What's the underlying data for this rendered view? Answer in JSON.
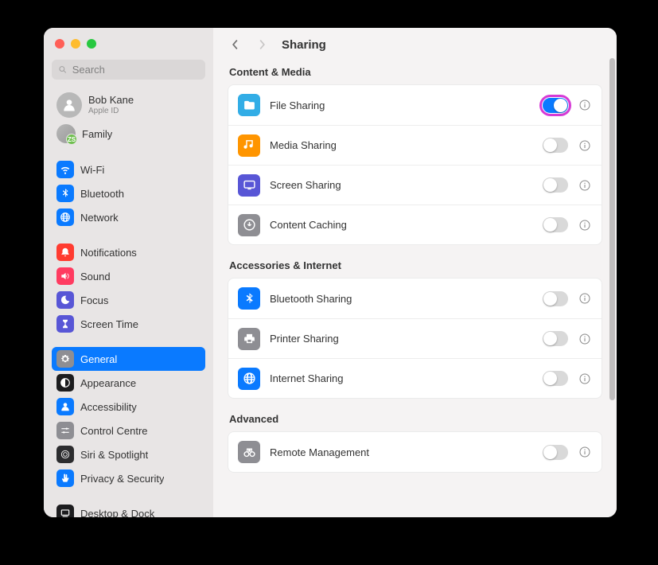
{
  "search": {
    "placeholder": "Search"
  },
  "user": {
    "name": "Bob Kane",
    "sub": "Apple ID"
  },
  "family": {
    "label": "Family",
    "badge": "ZS"
  },
  "sidebar_groups": [
    [
      {
        "id": "wifi",
        "label": "Wi-Fi",
        "bg": "#0a7aff",
        "icon": "wifi"
      },
      {
        "id": "bluetooth",
        "label": "Bluetooth",
        "bg": "#0a7aff",
        "icon": "bluetooth"
      },
      {
        "id": "network",
        "label": "Network",
        "bg": "#0a7aff",
        "icon": "globe"
      }
    ],
    [
      {
        "id": "notifications",
        "label": "Notifications",
        "bg": "#ff3b30",
        "icon": "bell"
      },
      {
        "id": "sound",
        "label": "Sound",
        "bg": "#ff3b60",
        "icon": "speaker"
      },
      {
        "id": "focus",
        "label": "Focus",
        "bg": "#5856d6",
        "icon": "moon"
      },
      {
        "id": "screen-time",
        "label": "Screen Time",
        "bg": "#5856d6",
        "icon": "hourglass"
      }
    ],
    [
      {
        "id": "general",
        "label": "General",
        "bg": "#8e8e93",
        "icon": "gear",
        "selected": true
      },
      {
        "id": "appearance",
        "label": "Appearance",
        "bg": "#1c1c1e",
        "icon": "appearance"
      },
      {
        "id": "accessibility",
        "label": "Accessibility",
        "bg": "#0a7aff",
        "icon": "person"
      },
      {
        "id": "control-centre",
        "label": "Control Centre",
        "bg": "#8e8e93",
        "icon": "sliders"
      },
      {
        "id": "siri",
        "label": "Siri & Spotlight",
        "bg": "#2c2c2e",
        "icon": "siri"
      },
      {
        "id": "privacy",
        "label": "Privacy & Security",
        "bg": "#0a7aff",
        "icon": "hand"
      }
    ],
    [
      {
        "id": "desktop-dock",
        "label": "Desktop & Dock",
        "bg": "#1c1c1e",
        "icon": "dock"
      }
    ]
  ],
  "page": {
    "title": "Sharing"
  },
  "sections": [
    {
      "title": "Content & Media",
      "rows": [
        {
          "id": "file-sharing",
          "label": "File Sharing",
          "bg": "#32ade6",
          "icon": "folder",
          "on": true,
          "highlight": true
        },
        {
          "id": "media-sharing",
          "label": "Media Sharing",
          "bg": "#ff9500",
          "icon": "media",
          "on": false
        },
        {
          "id": "screen-sharing",
          "label": "Screen Sharing",
          "bg": "#5856d6",
          "icon": "screen",
          "on": false
        },
        {
          "id": "content-caching",
          "label": "Content Caching",
          "bg": "#8e8e93",
          "icon": "download",
          "on": false
        }
      ]
    },
    {
      "title": "Accessories & Internet",
      "rows": [
        {
          "id": "bluetooth-sharing",
          "label": "Bluetooth Sharing",
          "bg": "#0a7aff",
          "icon": "bluetooth",
          "on": false
        },
        {
          "id": "printer-sharing",
          "label": "Printer Sharing",
          "bg": "#8e8e93",
          "icon": "printer",
          "on": false
        },
        {
          "id": "internet-sharing",
          "label": "Internet Sharing",
          "bg": "#0a7aff",
          "icon": "globe",
          "on": false
        }
      ]
    },
    {
      "title": "Advanced",
      "rows": [
        {
          "id": "remote-management",
          "label": "Remote Management",
          "bg": "#8e8e93",
          "icon": "binoculars",
          "on": false
        }
      ]
    }
  ]
}
